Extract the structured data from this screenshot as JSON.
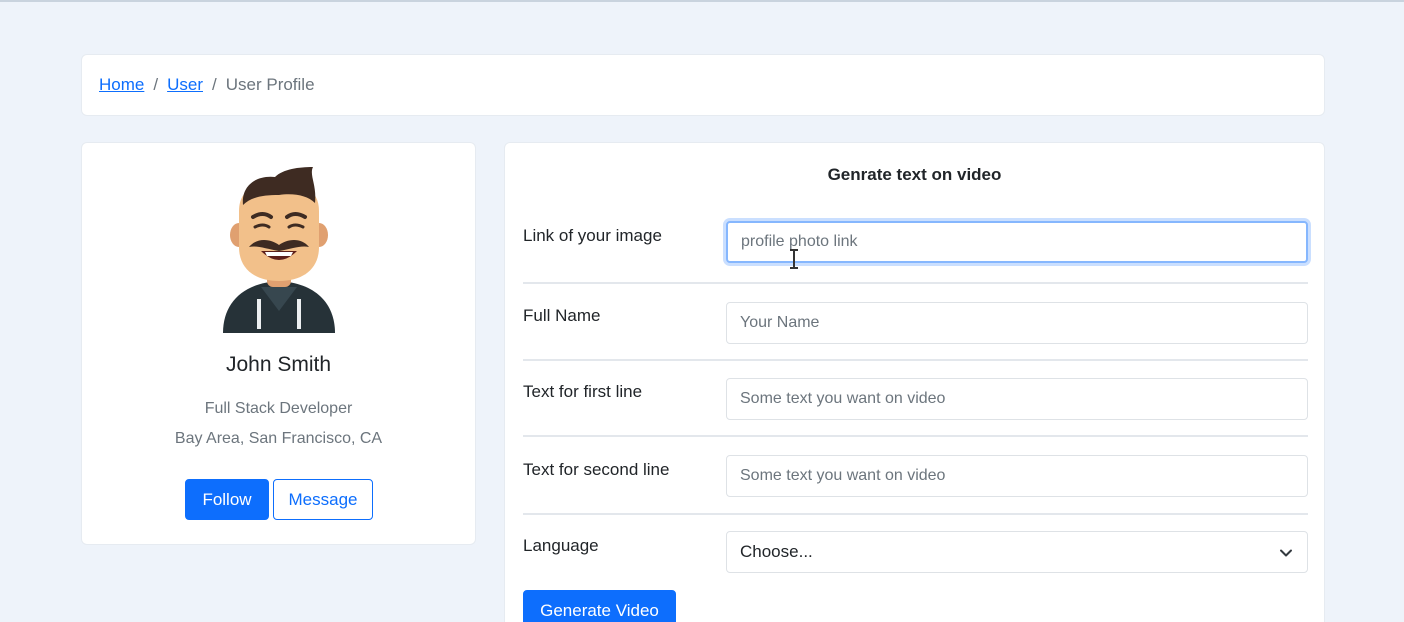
{
  "breadcrumb": {
    "home": "Home",
    "user": "User",
    "current": "User Profile",
    "separator": "/"
  },
  "profile": {
    "name": "John Smith",
    "role": "Full Stack Developer",
    "location": "Bay Area, San Francisco, CA",
    "follow_label": "Follow",
    "message_label": "Message",
    "avatar_icon": "cartoon-avatar-icon"
  },
  "form": {
    "title": "Genrate text on video",
    "image_link": {
      "label": "Link of your image",
      "placeholder": "profile photo link",
      "value": ""
    },
    "full_name": {
      "label": "Full Name",
      "placeholder": "Your Name",
      "value": ""
    },
    "first_line": {
      "label": "Text for first line",
      "placeholder": "Some text you want on video",
      "value": ""
    },
    "second_line": {
      "label": "Text for second line",
      "placeholder": "Some text you want on video",
      "value": ""
    },
    "language": {
      "label": "Language",
      "selected": "Choose..."
    },
    "submit_label": "Generate Video"
  },
  "colors": {
    "primary": "#0d6efd",
    "background": "#eef3fa",
    "muted_text": "#6c757d",
    "focus_ring": "#86b7fe"
  }
}
